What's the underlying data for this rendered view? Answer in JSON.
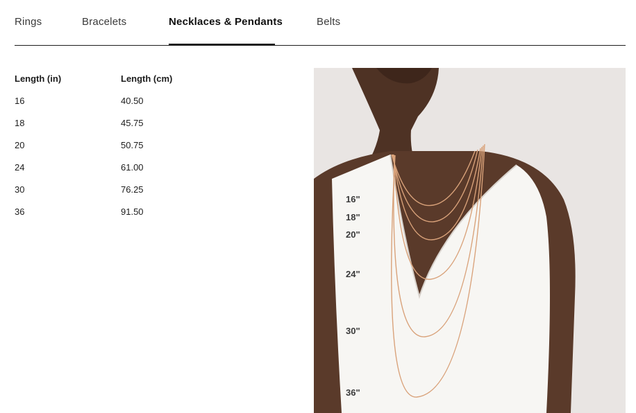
{
  "tabs": [
    {
      "label": "Rings",
      "active": false
    },
    {
      "label": "Bracelets",
      "active": false
    },
    {
      "label": "Necklaces & Pendants",
      "active": true
    },
    {
      "label": "Belts",
      "active": false
    }
  ],
  "table": {
    "headers": [
      "Length (in)",
      "Length (cm)"
    ],
    "rows": [
      [
        "16",
        "40.50"
      ],
      [
        "18",
        "45.75"
      ],
      [
        "20",
        "50.75"
      ],
      [
        "24",
        "61.00"
      ],
      [
        "30",
        "76.25"
      ],
      [
        "36",
        "91.50"
      ]
    ]
  },
  "photo": {
    "labels": [
      "16\"",
      "18\"",
      "20\"",
      "24\"",
      "30\"",
      "36\""
    ]
  },
  "colors": {
    "text": "#1d1d1d",
    "chain": "#d9a27a",
    "skin": "#5a3a2a",
    "top": "#f7f6f3",
    "background": "#e9e5e3"
  }
}
